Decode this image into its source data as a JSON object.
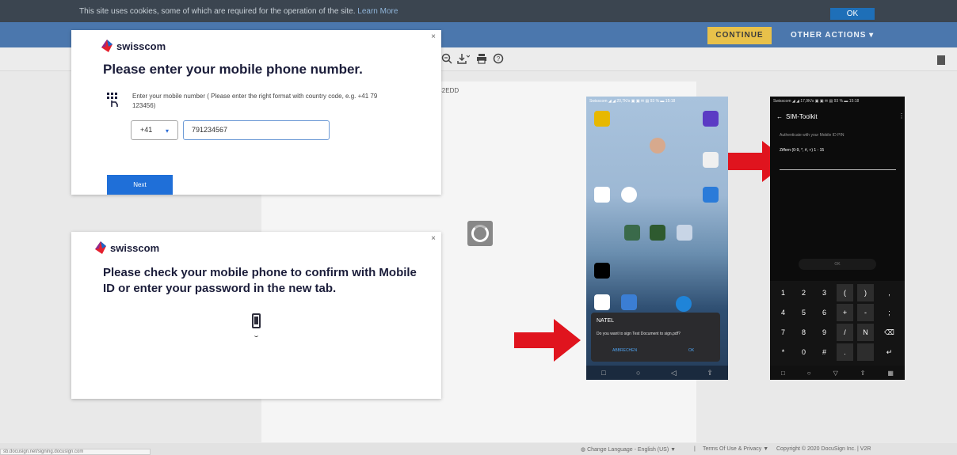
{
  "cookie_bar": {
    "text": "This site uses cookies, some of which are required for the operation of the site.",
    "learn_more": "Learn More",
    "ok": "OK"
  },
  "header": {
    "continue": "CONTINUE",
    "other_actions": "OTHER ACTIONS ▾"
  },
  "document": {
    "id_fragment": "C2EDD"
  },
  "dialog_phone": {
    "brand": "swisscom",
    "title": "Please enter your mobile phone number.",
    "hint": "Enter your mobile number ( Please enter the right format with country code, e.g. +41 79 123456)",
    "country_code": "+41",
    "phone_value": "791234567",
    "next": "Next",
    "close": "×"
  },
  "dialog_confirm": {
    "brand": "swisscom",
    "title": "Please check your mobile phone to confirm with Mobile ID or enter your password in the new tab.",
    "close": "×"
  },
  "phone_home": {
    "status": "Swisscom ◢ ◢ 20,7K/s ▣ ▣ ✉ ▤ 93 % ▬ 15:18",
    "notification_title": "NATEL",
    "notification_message": "Do you want to sign Test Document to sign.pdf?",
    "cancel": "ABBRECHEN",
    "ok": "OK",
    "nav": [
      "□",
      "○",
      "◁",
      "⇪"
    ]
  },
  "phone_sim": {
    "status": "Swisscom ◢ ◢ 17,9K/s ▣ ▣ ✉ ▤ 93 % ▬ 15:18",
    "back": "←",
    "title": "SIM-Toolkit",
    "menu": "⋮",
    "auth_text": "Authenticate with your Mobile ID PIN",
    "field_label": "Ziffern (0-9, *, #, +) 1 - 15",
    "ok": "OK",
    "keys": [
      "1",
      "2",
      "3",
      "(",
      ")",
      ",",
      "4",
      "5",
      "6",
      "+",
      "-",
      ";",
      "7",
      "8",
      "9",
      "/",
      "N",
      "⌫",
      "*",
      "0",
      "#",
      ".",
      "",
      "↵"
    ],
    "nav": [
      "□",
      "○",
      "▽",
      "⇪",
      "▦"
    ]
  },
  "footer": {
    "language": "Change Language - English (US) ▼",
    "terms": "Terms Of Use & Privacy ▼",
    "copyright": "Copyright © 2020 DocuSign Inc. | V2R",
    "status_url": "sb.docusign.net/signing.docusign.com"
  },
  "colors": {
    "header_blue": "#4b77ad",
    "continue_yellow": "#e8c14a",
    "next_blue": "#1f6fd8",
    "arrow_red": "#e0141e",
    "swisscom_red": "#e5202e"
  },
  "icons": {
    "toolbar": [
      "zoom-icon",
      "download-icon",
      "print-icon",
      "help-icon"
    ],
    "right": "document-icon"
  }
}
